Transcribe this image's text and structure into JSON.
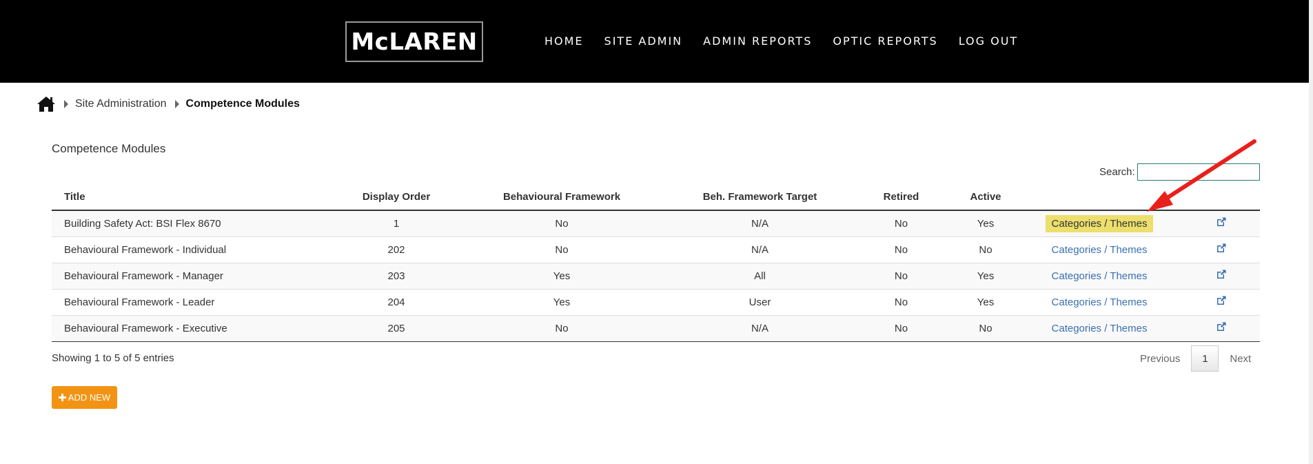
{
  "header": {
    "logo_text": "McLAREN",
    "nav": [
      "HOME",
      "SITE ADMIN",
      "ADMIN REPORTS",
      "OPTIC REPORTS",
      "LOG OUT"
    ]
  },
  "breadcrumb": {
    "items": [
      "Site Administration",
      "Competence Modules"
    ]
  },
  "main": {
    "title": "Competence Modules",
    "search_label": "Search:",
    "search_value": "",
    "columns": [
      "Title",
      "Display Order",
      "Behavioural Framework",
      "Beh. Framework Target",
      "Retired",
      "Active"
    ],
    "rows": [
      {
        "title": "Building Safety Act: BSI Flex 8670",
        "order": "1",
        "framework": "No",
        "target": "N/A",
        "retired": "No",
        "active": "Yes",
        "link": "Categories / Themes"
      },
      {
        "title": "Behavioural Framework - Individual",
        "order": "202",
        "framework": "No",
        "target": "N/A",
        "retired": "No",
        "active": "No",
        "link": "Categories / Themes"
      },
      {
        "title": "Behavioural Framework - Manager",
        "order": "203",
        "framework": "Yes",
        "target": "All",
        "retired": "No",
        "active": "Yes",
        "link": "Categories / Themes"
      },
      {
        "title": "Behavioural Framework - Leader",
        "order": "204",
        "framework": "Yes",
        "target": "User",
        "retired": "No",
        "active": "Yes",
        "link": "Categories / Themes"
      },
      {
        "title": "Behavioural Framework - Executive",
        "order": "205",
        "framework": "No",
        "target": "N/A",
        "retired": "No",
        "active": "No",
        "link": "Categories / Themes"
      }
    ],
    "showing": "Showing 1 to 5 of 5 entries",
    "pager": {
      "previous": "Previous",
      "page": "1",
      "next": "Next"
    },
    "add_button": "ADD NEW"
  },
  "colors": {
    "header_bg": "#000000",
    "link": "#3a6fb0",
    "highlight": "#ecdf6d",
    "button": "#f39314",
    "arrow": "#e8201c"
  },
  "icons": [
    "home-icon",
    "caret-right-icon",
    "external-link-icon",
    "plus-icon",
    "annotation-arrow"
  ]
}
